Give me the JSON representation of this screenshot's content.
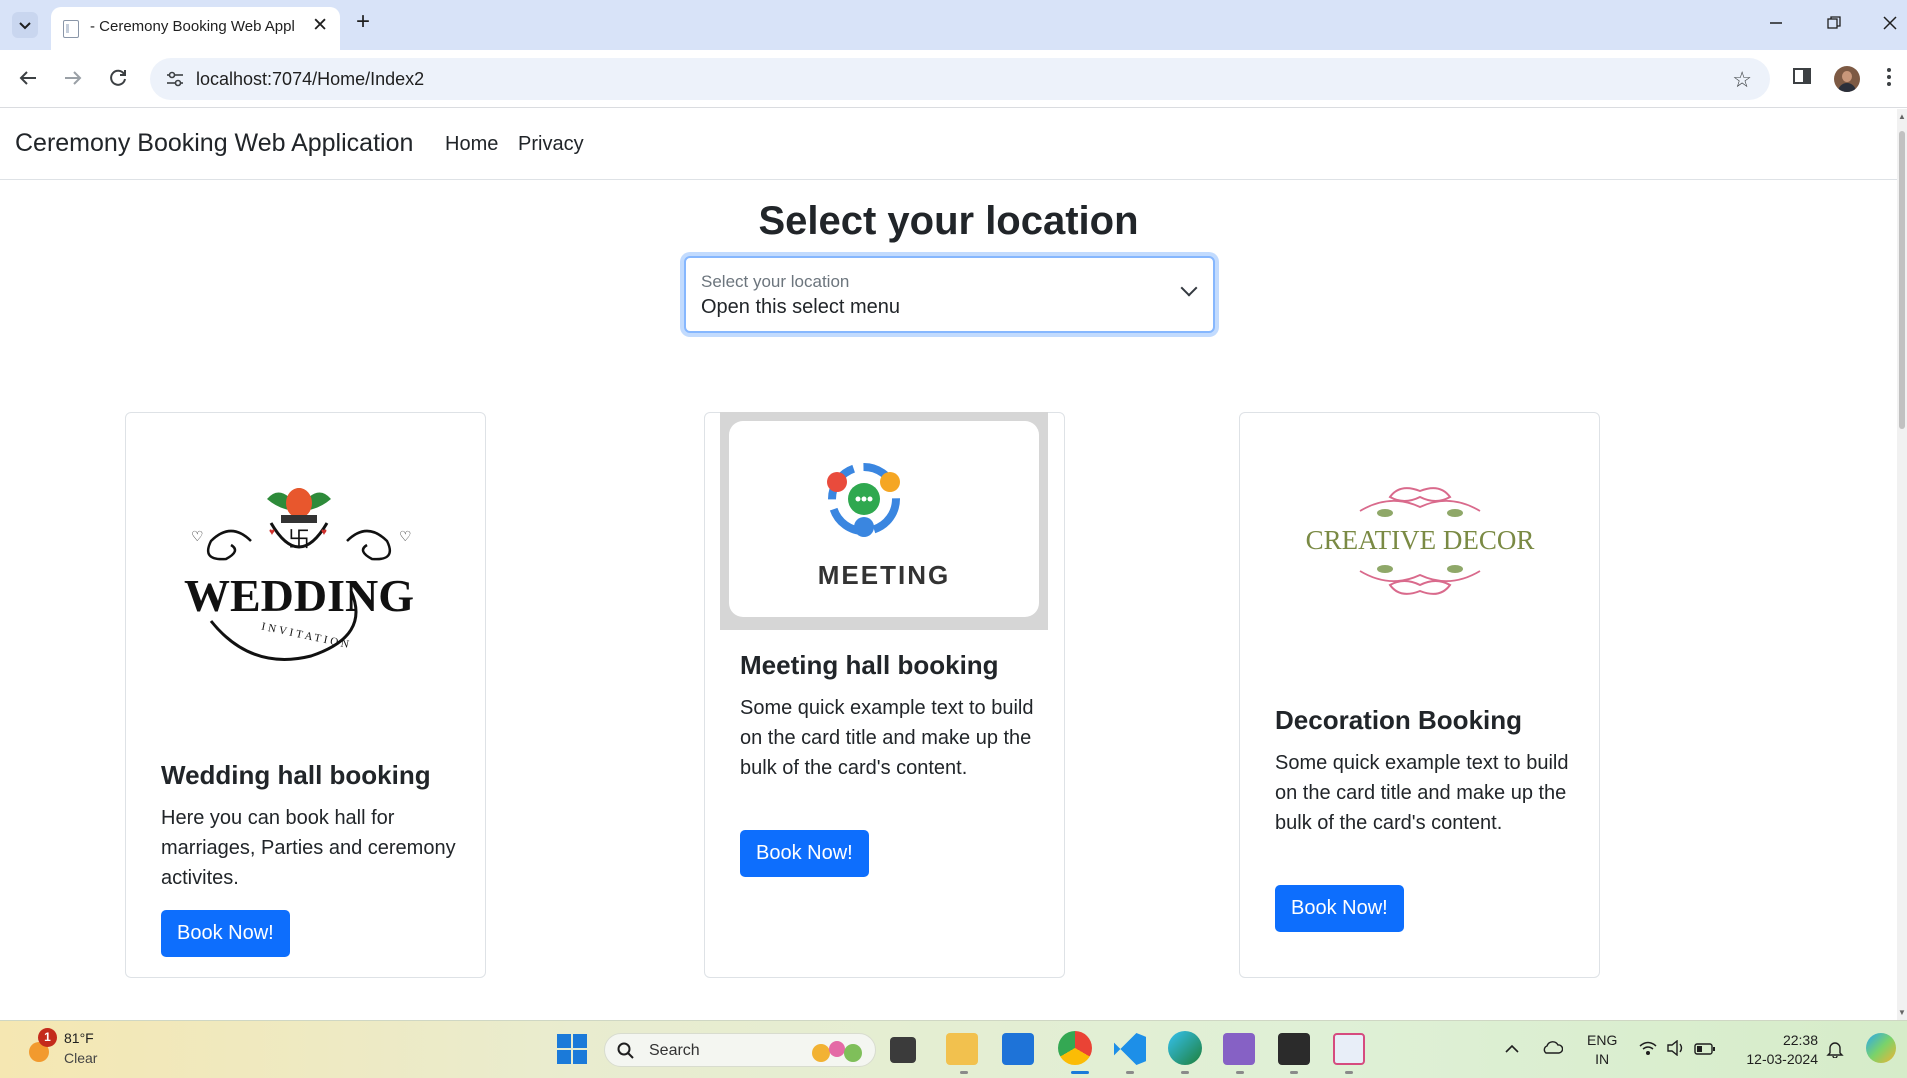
{
  "browser": {
    "tab_title": "- Ceremony Booking Web Appli",
    "url": "localhost:7074/Home/Index2"
  },
  "site": {
    "brand": "Ceremony Booking Web Application",
    "nav": [
      "Home",
      "Privacy"
    ]
  },
  "main": {
    "heading": "Select your location",
    "select_label": "Select your location",
    "select_value": "Open this select menu"
  },
  "cards": [
    {
      "image_alt": "WEDDING",
      "image_sub": "INVITATION",
      "title": "Wedding hall booking",
      "text": "Here you can book hall for marriages, Parties and ceremony activites.",
      "button": "Book Now!"
    },
    {
      "image_alt": "MEETING",
      "title": "Meeting hall booking",
      "text": "Some quick example text to build on the card title and make up the bulk of the card's content.",
      "button": "Book Now!"
    },
    {
      "image_alt": "CREATIVE DECOR",
      "title": "Decoration Booking",
      "text": "Some quick example text to build on the card title and make up the bulk of the card's content.",
      "button": "Book Now!"
    }
  ],
  "taskbar": {
    "weather_badge": "1",
    "temperature": "81°F",
    "condition": "Clear",
    "search": "Search",
    "lang_top": "ENG",
    "lang_bottom": "IN",
    "time": "22:38",
    "date": "12-03-2024"
  },
  "colors": {
    "primary": "#0d6efd",
    "focus_border": "#86b7fe",
    "tabstrip": "#d8e3f8"
  }
}
